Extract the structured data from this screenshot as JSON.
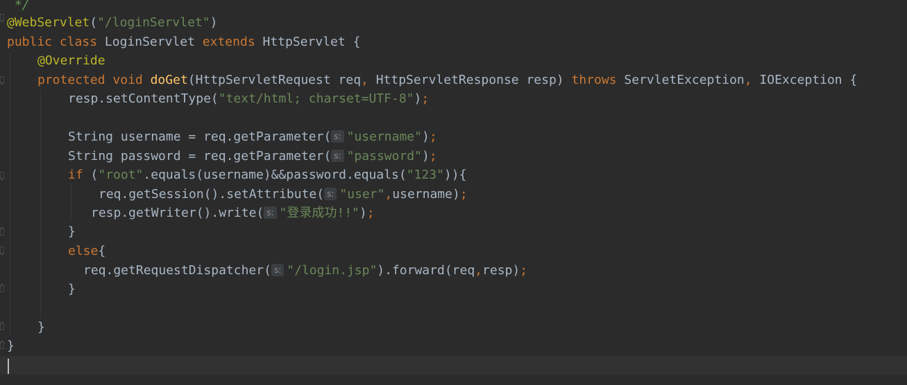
{
  "editor": {
    "language": "java",
    "colors": {
      "background": "#2b2b2b",
      "keyword": "#cc7832",
      "string": "#6a8759",
      "annotation": "#bbb529",
      "comment": "#629755",
      "method_declaration": "#ffc66d",
      "plain": "#a9b7c6",
      "param_hint_bg": "#3b3f41"
    },
    "hint_label": "s:",
    "lines": {
      "l1": {
        "comment": " */"
      },
      "l2": {
        "ann": "@WebServlet",
        "p1": "(",
        "str": "\"/loginServlet\"",
        "p2": ")"
      },
      "l3": {
        "kw1": "public",
        "kw2": "class",
        "name": "LoginServlet",
        "kw3": "extends",
        "sup": "HttpServlet",
        "brace": "{"
      },
      "l4": {
        "ann": "@Override"
      },
      "l5": {
        "kw1": "protected",
        "kw2": "void",
        "fn": "doGet",
        "p1": "(HttpServletRequest req",
        "c1": ",",
        "p2": " HttpServletResponse resp) ",
        "kw3": "throws",
        "e1": " ServletException",
        "c2": ",",
        "e2": " IOException {"
      },
      "l6": {
        "a": "resp.setContentType(",
        "str": "\"text/html; charset=UTF-8\"",
        "b": ")",
        "semi": ";"
      },
      "l8": {
        "a": "String username = req.getParameter(",
        "str": "\"username\"",
        "b": ")",
        "semi": ";"
      },
      "l9": {
        "a": "String password = req.getParameter(",
        "str": "\"password\"",
        "b": ")",
        "semi": ";"
      },
      "l10": {
        "kw": "if",
        "a": " (",
        "s1": "\"root\"",
        "b": ".equals(username)&&password.equals(",
        "s2": "\"123\"",
        "c": ")){"
      },
      "l11": {
        "a": "req.getSession().setAttribute(",
        "str": "\"user\"",
        "comma": ",",
        "b": "username)",
        "semi": ";"
      },
      "l12": {
        "a": "resp.getWriter().write(",
        "str": "\"登录成功!!\"",
        "b": ")",
        "semi": ";"
      },
      "l13": {
        "brace": "}"
      },
      "l14": {
        "kw": "else",
        "brace": "{"
      },
      "l15": {
        "a": "req.getRequestDispatcher(",
        "str": "\"/login.jsp\"",
        "b": ").forward(req",
        "comma": ",",
        "c": "resp)",
        "semi": ";"
      },
      "l16": {
        "brace": "}"
      },
      "l18": {
        "brace": "}"
      },
      "l19": {
        "brace": "}"
      }
    }
  }
}
